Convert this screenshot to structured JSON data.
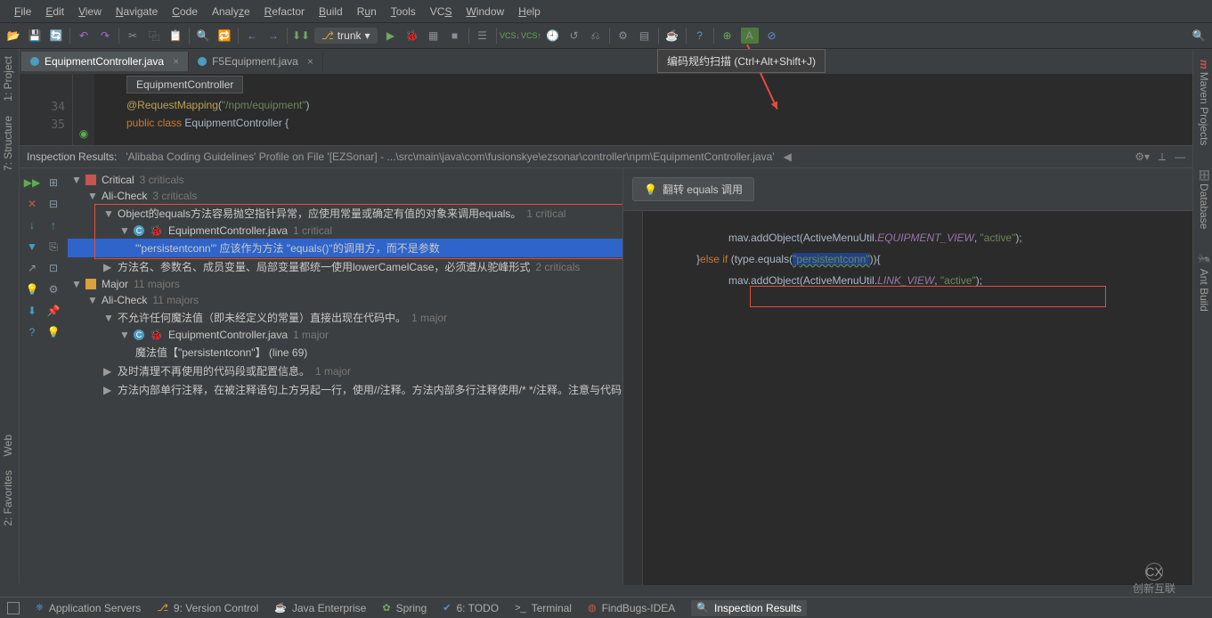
{
  "menu": [
    "File",
    "Edit",
    "View",
    "Navigate",
    "Code",
    "Analyze",
    "Refactor",
    "Build",
    "Run",
    "Tools",
    "VCS",
    "Window",
    "Help"
  ],
  "menu_accel": [
    "F",
    "E",
    "V",
    "N",
    "C",
    "",
    "R",
    "B",
    "u",
    "T",
    "S",
    "W",
    "H"
  ],
  "branch": "trunk",
  "tooltip": "编码规约扫描 (Ctrl+Alt+Shift+J)",
  "tabs": [
    {
      "label": "EquipmentController.java",
      "active": true
    },
    {
      "label": "F5Equipment.java",
      "active": false
    }
  ],
  "editor": {
    "classname": "EquipmentController",
    "line34_num": "34",
    "line35_num": "35",
    "ann": "@RequestMapping",
    "path": "\"/npm/equipment\"",
    "kw_public": "public",
    "kw_class": "class",
    "cls": "EquipmentController",
    "brace": "{"
  },
  "inspect_title": "Inspection Results:",
  "inspect_path": "'Alibaba Coding Guidelines' Profile on File '[EZSonar] - ...\\src\\main\\java\\com\\fusionskye\\ezsonar\\controller\\npm\\EquipmentController.java'",
  "tree": {
    "critical": "Critical",
    "critical_cnt": "3 criticals",
    "alicheck": "Ali-Check",
    "alicheck_cnt": "3 criticals",
    "rule1": "Object的equals方法容易抛空指针异常，应使用常量或确定有值的对象来调用equals。",
    "rule1_cnt": "1 critical",
    "file1": "EquipmentController.java",
    "file1_cnt": "1 critical",
    "sel": "'\"persistentconn\"' 应该作为方法 \"equals()\"的调用方，而不是参数",
    "rule2": "方法名、参数名、成员变量、局部变量都统一使用lowerCamelCase，必须遵从驼峰形式",
    "rule2_cnt": "2 criticals",
    "major": "Major",
    "major_cnt": "11 majors",
    "alicheck2": "Ali-Check",
    "alicheck2_cnt": "11 majors",
    "rule3": "不允许任何魔法值（即未经定义的常量）直接出现在代码中。",
    "rule3_cnt": "1 major",
    "file2": "EquipmentController.java",
    "file2_cnt": "1 major",
    "magic": "魔法值【\"persistentconn\"】  (line 69)",
    "rule4": "及时清理不再使用的代码段或配置信息。",
    "rule4_cnt": "1 major",
    "rule5": "方法内部单行注释，在被注释语句上方另起一行，使用//注释。方法内部多行注释使用/* */注释。注意与代码"
  },
  "right_btn": "翻转 equals 调用",
  "code_right": {
    "l1": "mav.addObject(ActiveMenuUtil.",
    "stat1": "EQUIPMENT_VIEW",
    "l1b": ", ",
    "str1": "\"active\"",
    "l1c": ");",
    "brace": "}",
    "kw_else": "else if ",
    "l2a": "(type.equals(",
    "hl": "\"persistentconn\"",
    "l2b": ")){",
    "l3": "mav.addObject(ActiveMenuUtil.",
    "stat2": "LINK_VIEW",
    "l3b": ", ",
    "str2": "\"active\"",
    "l3c": ");"
  },
  "left_tabs": [
    "1: Project",
    "7: Structure"
  ],
  "left_tabs2": [
    "Web",
    "2: Favorites"
  ],
  "right_tabs": [
    "Maven Projects",
    "Database",
    "Ant Build"
  ],
  "status": [
    {
      "ico": "⎈",
      "label": "Application Servers"
    },
    {
      "ico": "↗",
      "label": "9: Version Control"
    },
    {
      "ico": "☕",
      "label": "Java Enterprise"
    },
    {
      "ico": "✿",
      "label": "Spring"
    },
    {
      "ico": "✔",
      "label": "6: TODO"
    },
    {
      "ico": ">_",
      "label": "Terminal"
    },
    {
      "ico": "◍",
      "label": "FindBugs-IDEA"
    },
    {
      "ico": "🔍",
      "label": "Inspection Results",
      "active": true
    }
  ],
  "logo": "创新互联"
}
